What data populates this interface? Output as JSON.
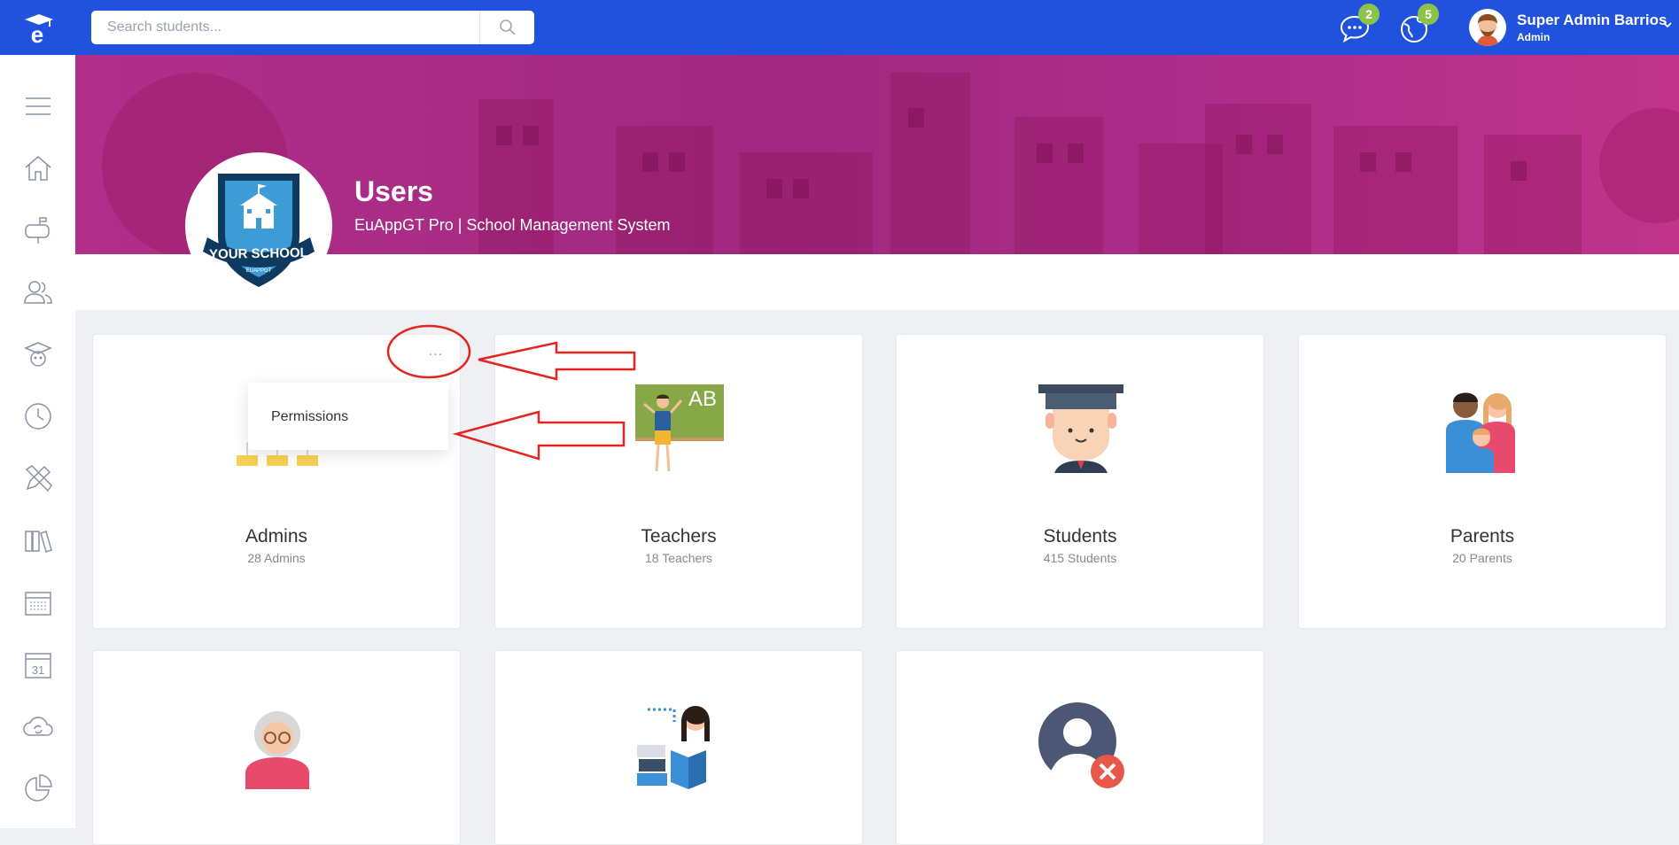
{
  "search": {
    "placeholder": "Search students..."
  },
  "topbar": {
    "messages_badge": "2",
    "notifications_badge": "5",
    "user": {
      "name": "Super Admin Barrios",
      "role": "Admin"
    }
  },
  "header": {
    "title": "Users",
    "subtitle": "EuAppGT Pro | School Management System",
    "logo_text": "YOUR SCHOOL",
    "logo_subtext": "EUAPPGT"
  },
  "cards": [
    {
      "title": "Admins",
      "count": "28 Admins"
    },
    {
      "title": "Teachers",
      "count": "18 Teachers"
    },
    {
      "title": "Students",
      "count": "415 Students"
    },
    {
      "title": "Parents",
      "count": "20 Parents"
    }
  ],
  "dropdown": {
    "item": "Permissions"
  },
  "teacher_board_text": "AB",
  "colors": {
    "topbar": "#2152de",
    "banner": "#a8287f",
    "badge": "#8bc34a",
    "annotation": "#e52420"
  }
}
